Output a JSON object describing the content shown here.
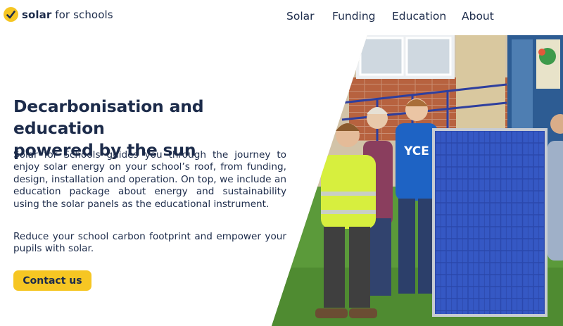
{
  "brand": {
    "name_bold": "solar",
    "name_rest": " for schools"
  },
  "nav": {
    "items": [
      {
        "label": "Solar"
      },
      {
        "label": "Funding"
      },
      {
        "label": "Education"
      },
      {
        "label": "About"
      }
    ]
  },
  "hero": {
    "headline_line1": "Decarbonisation and education",
    "headline_line2": "powered by the sun",
    "paragraph1": "Solar for Schools guides you through the journey to enjoy solar energy on your school’s roof, from funding, design, installation and operation. On top, we include an education package about energy and sustainability using the solar panels as the educational instrument.",
    "paragraph2": "Reduce your school carbon footprint and empower your pupils with solar.",
    "cta_label": "Contact us",
    "tshirt_text": "YCE"
  },
  "colors": {
    "accent": "#f6c623",
    "text": "#1c2b4a",
    "panel_blue": "#2e4fb5",
    "grass": "#5b9a3a"
  },
  "icons": {
    "logo": "checkmark-badge-icon"
  }
}
